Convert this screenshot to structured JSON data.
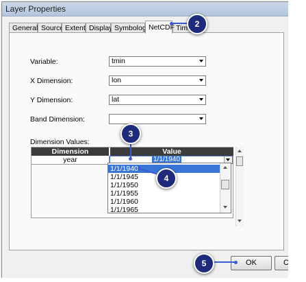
{
  "window": {
    "title": "Layer Properties"
  },
  "tabs": [
    {
      "label": "General"
    },
    {
      "label": "Source"
    },
    {
      "label": "Extent"
    },
    {
      "label": "Display"
    },
    {
      "label": "Symbology"
    },
    {
      "label": "NetCDF",
      "active": true
    },
    {
      "label": "Time"
    }
  ],
  "form": {
    "variable": {
      "label": "Variable:",
      "value": "tmin"
    },
    "x_dimension": {
      "label": "X Dimension:",
      "value": "lon"
    },
    "y_dimension": {
      "label": "Y Dimension:",
      "value": "lat"
    },
    "band_dimension": {
      "label": "Band Dimension:",
      "value": ""
    }
  },
  "dimension_values": {
    "label": "Dimension Values:",
    "headers": [
      "Dimension",
      "Value"
    ],
    "row": {
      "dimension": "year",
      "value": "1/1/1940"
    },
    "options": [
      "1/1/1940",
      "1/1/1945",
      "1/1/1950",
      "1/1/1955",
      "1/1/1960",
      "1/1/1965"
    ],
    "selected_option": "1/1/1940"
  },
  "buttons": {
    "ok": "OK",
    "cancel": "Ca"
  },
  "callouts": [
    "2",
    "3",
    "4",
    "5"
  ],
  "colors": {
    "callout": "#1e2a7a",
    "leader": "#3b5bd6",
    "selection": "#3875d7"
  }
}
